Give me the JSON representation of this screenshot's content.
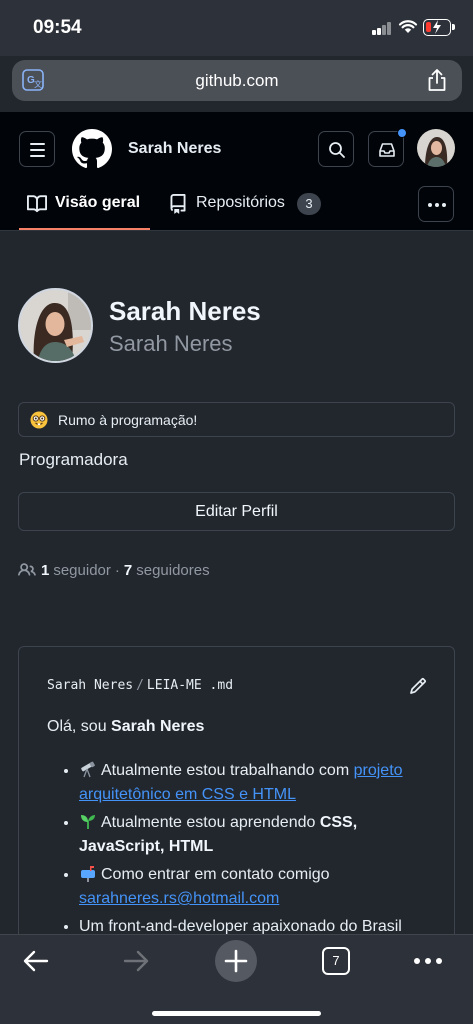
{
  "status_bar": {
    "time": "09:54"
  },
  "browser": {
    "url": "github.com",
    "tab_count": "7"
  },
  "header": {
    "username": "Sarah Neres",
    "tabs": [
      {
        "label": "Visão geral"
      },
      {
        "label": "Repositórios",
        "count": "3"
      }
    ]
  },
  "profile": {
    "name": "Sarah Neres",
    "login": "Sarah Neres",
    "status": "Rumo à programação!",
    "bio": "Programadora",
    "edit_label": "Editar Perfil",
    "following_count": "1",
    "following_label": "seguidor",
    "separator": "·",
    "followers_count": "7",
    "followers_label": "seguidores"
  },
  "readme": {
    "owner": "Sarah Neres",
    "separator": "/",
    "file": "LEIA-ME .md",
    "greeting_prefix": "Olá, sou ",
    "greeting_name": "Sarah Neres",
    "items": [
      {
        "text": "Atualmente estou trabalhando com ",
        "link": "projeto arquitetônico em CSS e HTML",
        "emoji": "telescope-emoji"
      },
      {
        "text": "Atualmente estou aprendendo ",
        "bold": "CSS, JavaScript, HTML",
        "emoji": "seedling-emoji"
      },
      {
        "text": "Como entrar em contato comigo ",
        "link": "sarahneres.rs@hotmail.com",
        "emoji": "mailbox-emoji"
      },
      {
        "text": "Um front-and-developer apaixonado do Brasil"
      }
    ]
  },
  "colors": {
    "background": "#22272e",
    "header_bg": "#010409",
    "accent_underline": "#f78166",
    "link": "#4493f8",
    "notification_dot": "#4493f8"
  }
}
